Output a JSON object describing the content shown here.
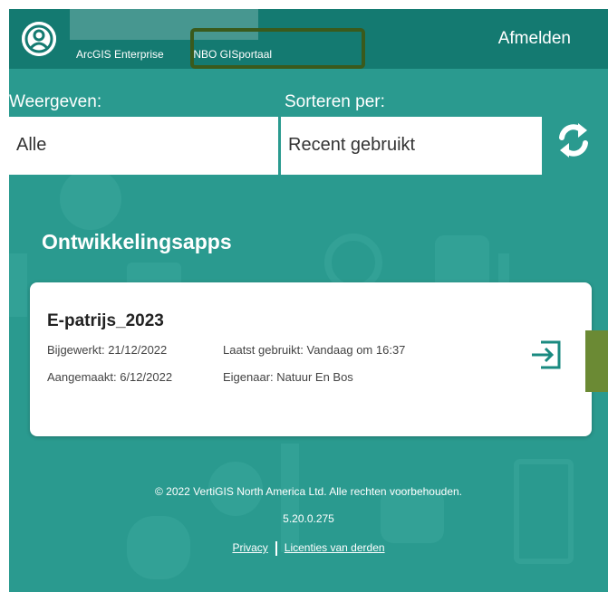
{
  "header": {
    "product_label": "ArcGIS Enterprise",
    "portal_name": "INBO GISportaal",
    "logout_label": "Afmelden",
    "avatar_icon": "user-avatar-icon"
  },
  "filters": {
    "show_label": "Weergeven:",
    "show_value": "Alle",
    "sort_label": "Sorteren per:",
    "sort_value": "Recent gebruikt",
    "refresh_icon": "refresh-icon"
  },
  "section": {
    "title": "Ontwikkelingsapps"
  },
  "app_card": {
    "title": "E-patrijs_2023",
    "updated": "Bijgewerkt: 21/12/2022",
    "last_used": "Laatst gebruikt: Vandaag om 16:37",
    "created": "Aangemaakt: 6/12/2022",
    "owner": "Eigenaar: Natuur En Bos",
    "open_icon": "open-app-icon"
  },
  "footer": {
    "copyright": "© 2022 VertiGIS North America Ltd. Alle rechten voorbehouden.",
    "version": "5.20.0.275",
    "privacy_link": "Privacy",
    "licenses_link": "Licenties van derden"
  },
  "colors": {
    "background": "#2a9a8f",
    "topbar": "#147a71",
    "highlight_border": "#3a5a1c",
    "side_marker": "#6b8a34",
    "accent_icon": "#1a8a80"
  }
}
